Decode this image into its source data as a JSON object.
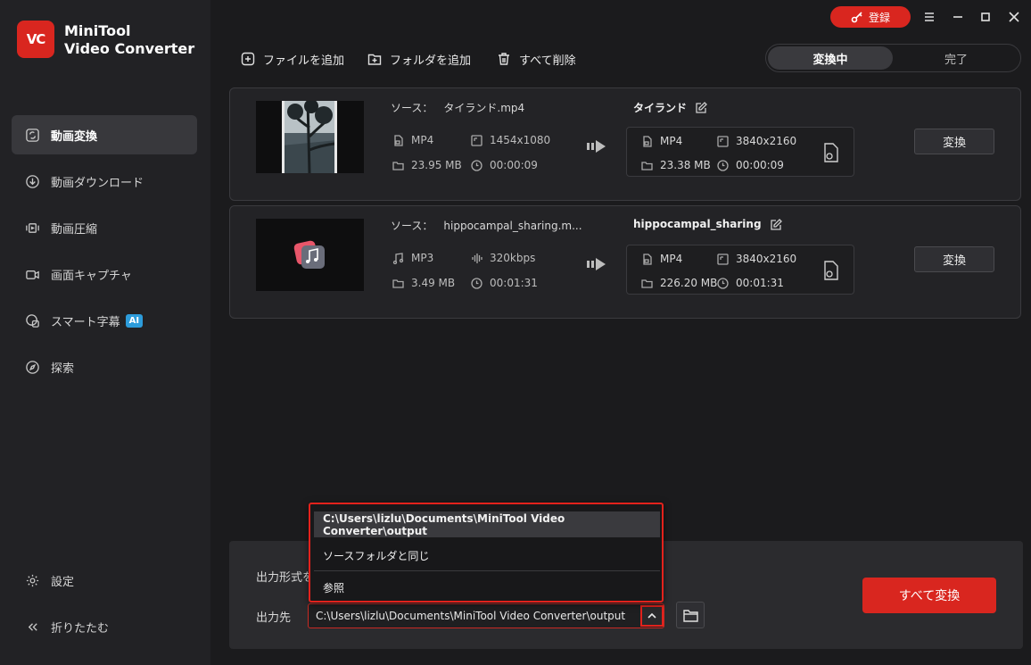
{
  "app": {
    "logo_text": "VC",
    "name_line1": "MiniTool",
    "name_line2": "Video Converter"
  },
  "titlebar": {
    "register_label": "登録"
  },
  "sidebar": {
    "items": [
      {
        "label": "動画変換",
        "icon": "convert-icon"
      },
      {
        "label": "動画ダウンロード",
        "icon": "download-icon"
      },
      {
        "label": "動画圧縮",
        "icon": "compress-icon"
      },
      {
        "label": "画面キャプチャ",
        "icon": "camera-icon"
      },
      {
        "label": "スマート字幕",
        "icon": "subtitle-icon",
        "badge": "AI"
      },
      {
        "label": "探索",
        "icon": "compass-icon"
      }
    ],
    "settings_label": "設定",
    "collapse_label": "折りたたむ"
  },
  "toolbar": {
    "add_file": "ファイルを追加",
    "add_folder": "フォルダを追加",
    "delete_all": "すべて削除"
  },
  "tabs": {
    "converting": "変換中",
    "done": "完了"
  },
  "files": [
    {
      "source_label": "ソース：",
      "source_name": "タイランド.mp4",
      "src_format": "MP4",
      "src_resolution": "1454x1080",
      "src_size": "23.95 MB",
      "src_duration": "00:00:09",
      "out_title": "タイランド",
      "out_format": "MP4",
      "out_resolution": "3840x2160",
      "out_size": "23.38 MB",
      "out_duration": "00:00:09",
      "convert_label": "変換"
    },
    {
      "source_label": "ソース：",
      "source_name": "hippocampal_sharing.m...",
      "src_format": "MP3",
      "src_bitrate": "320kbps",
      "src_size": "3.49 MB",
      "src_duration": "00:01:31",
      "out_title": "hippocampal_sharing",
      "out_format": "MP4",
      "out_resolution": "3840x2160",
      "out_size": "226.20 MB",
      "out_duration": "00:01:31",
      "convert_label": "変換"
    }
  ],
  "bottom": {
    "output_format_label": "出力形式を",
    "output_dest_label": "出力先",
    "output_path": "C:\\Users\\lizlu\\Documents\\MiniTool Video Converter\\output",
    "convert_all_label": "すべて変換"
  },
  "dropdown": {
    "options": [
      "C:\\Users\\lizlu\\Documents\\MiniTool Video Converter\\output",
      "ソースフォルダと同じ",
      "参照"
    ]
  },
  "colors": {
    "accent": "#d9261f",
    "ai_badge": "#2d9cdb"
  }
}
